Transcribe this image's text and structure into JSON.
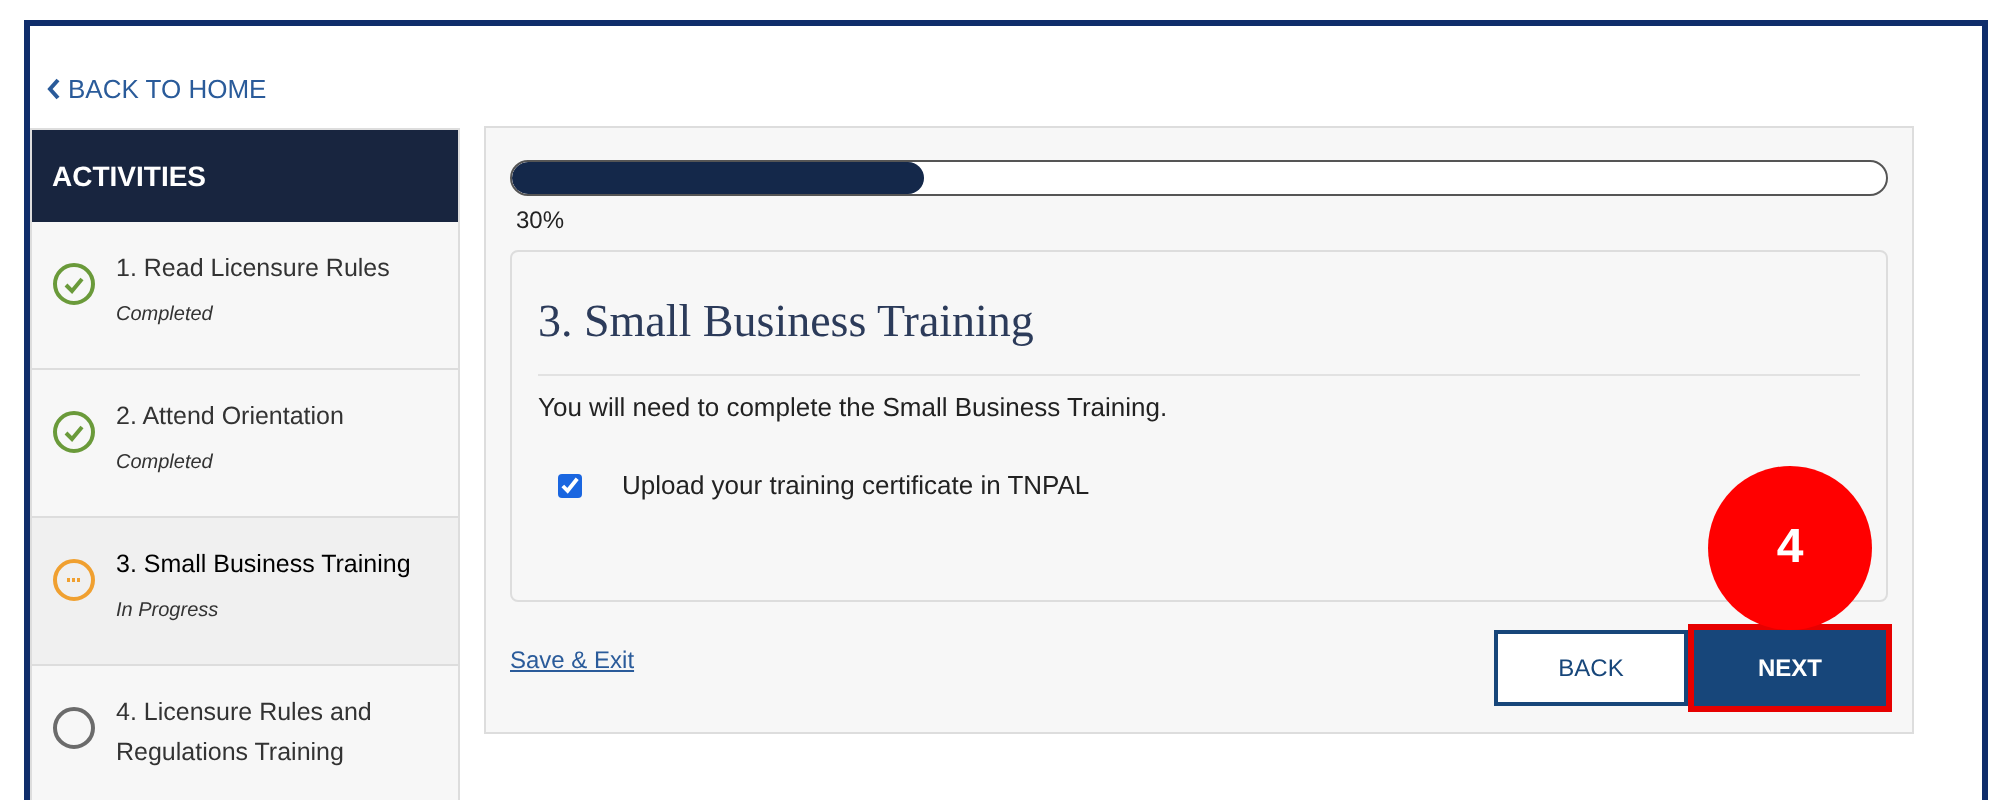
{
  "back_link": "BACK TO HOME",
  "sidebar": {
    "title": "ACTIVITIES",
    "items": [
      {
        "title": "1. Read Licensure Rules",
        "status": "Completed",
        "kind": "completed",
        "selected": false
      },
      {
        "title": "2. Attend Orientation",
        "status": "Completed",
        "kind": "completed",
        "selected": false
      },
      {
        "title": "3. Small Business Training",
        "status": "In Progress",
        "kind": "in_progress",
        "selected": true
      },
      {
        "title": "4. Licensure Rules and Regulations Training",
        "kind": "not_started",
        "selected": false
      }
    ]
  },
  "progress": {
    "level": 0.3,
    "reading": "30%"
  },
  "card": {
    "title": "3. Small Business Training",
    "text": "You will need to complete the Small Business Training.",
    "tasks": [
      {
        "label": "Upload your training certificate in TNPAL",
        "checked": true
      }
    ]
  },
  "save_link": "Save & Exit",
  "buttons": [
    {
      "label": "BACK",
      "kind": "secondary",
      "highlighted": false
    },
    {
      "label": "NEXT",
      "kind": "primary",
      "highlighted": true
    }
  ],
  "callout": {
    "label": "4"
  }
}
